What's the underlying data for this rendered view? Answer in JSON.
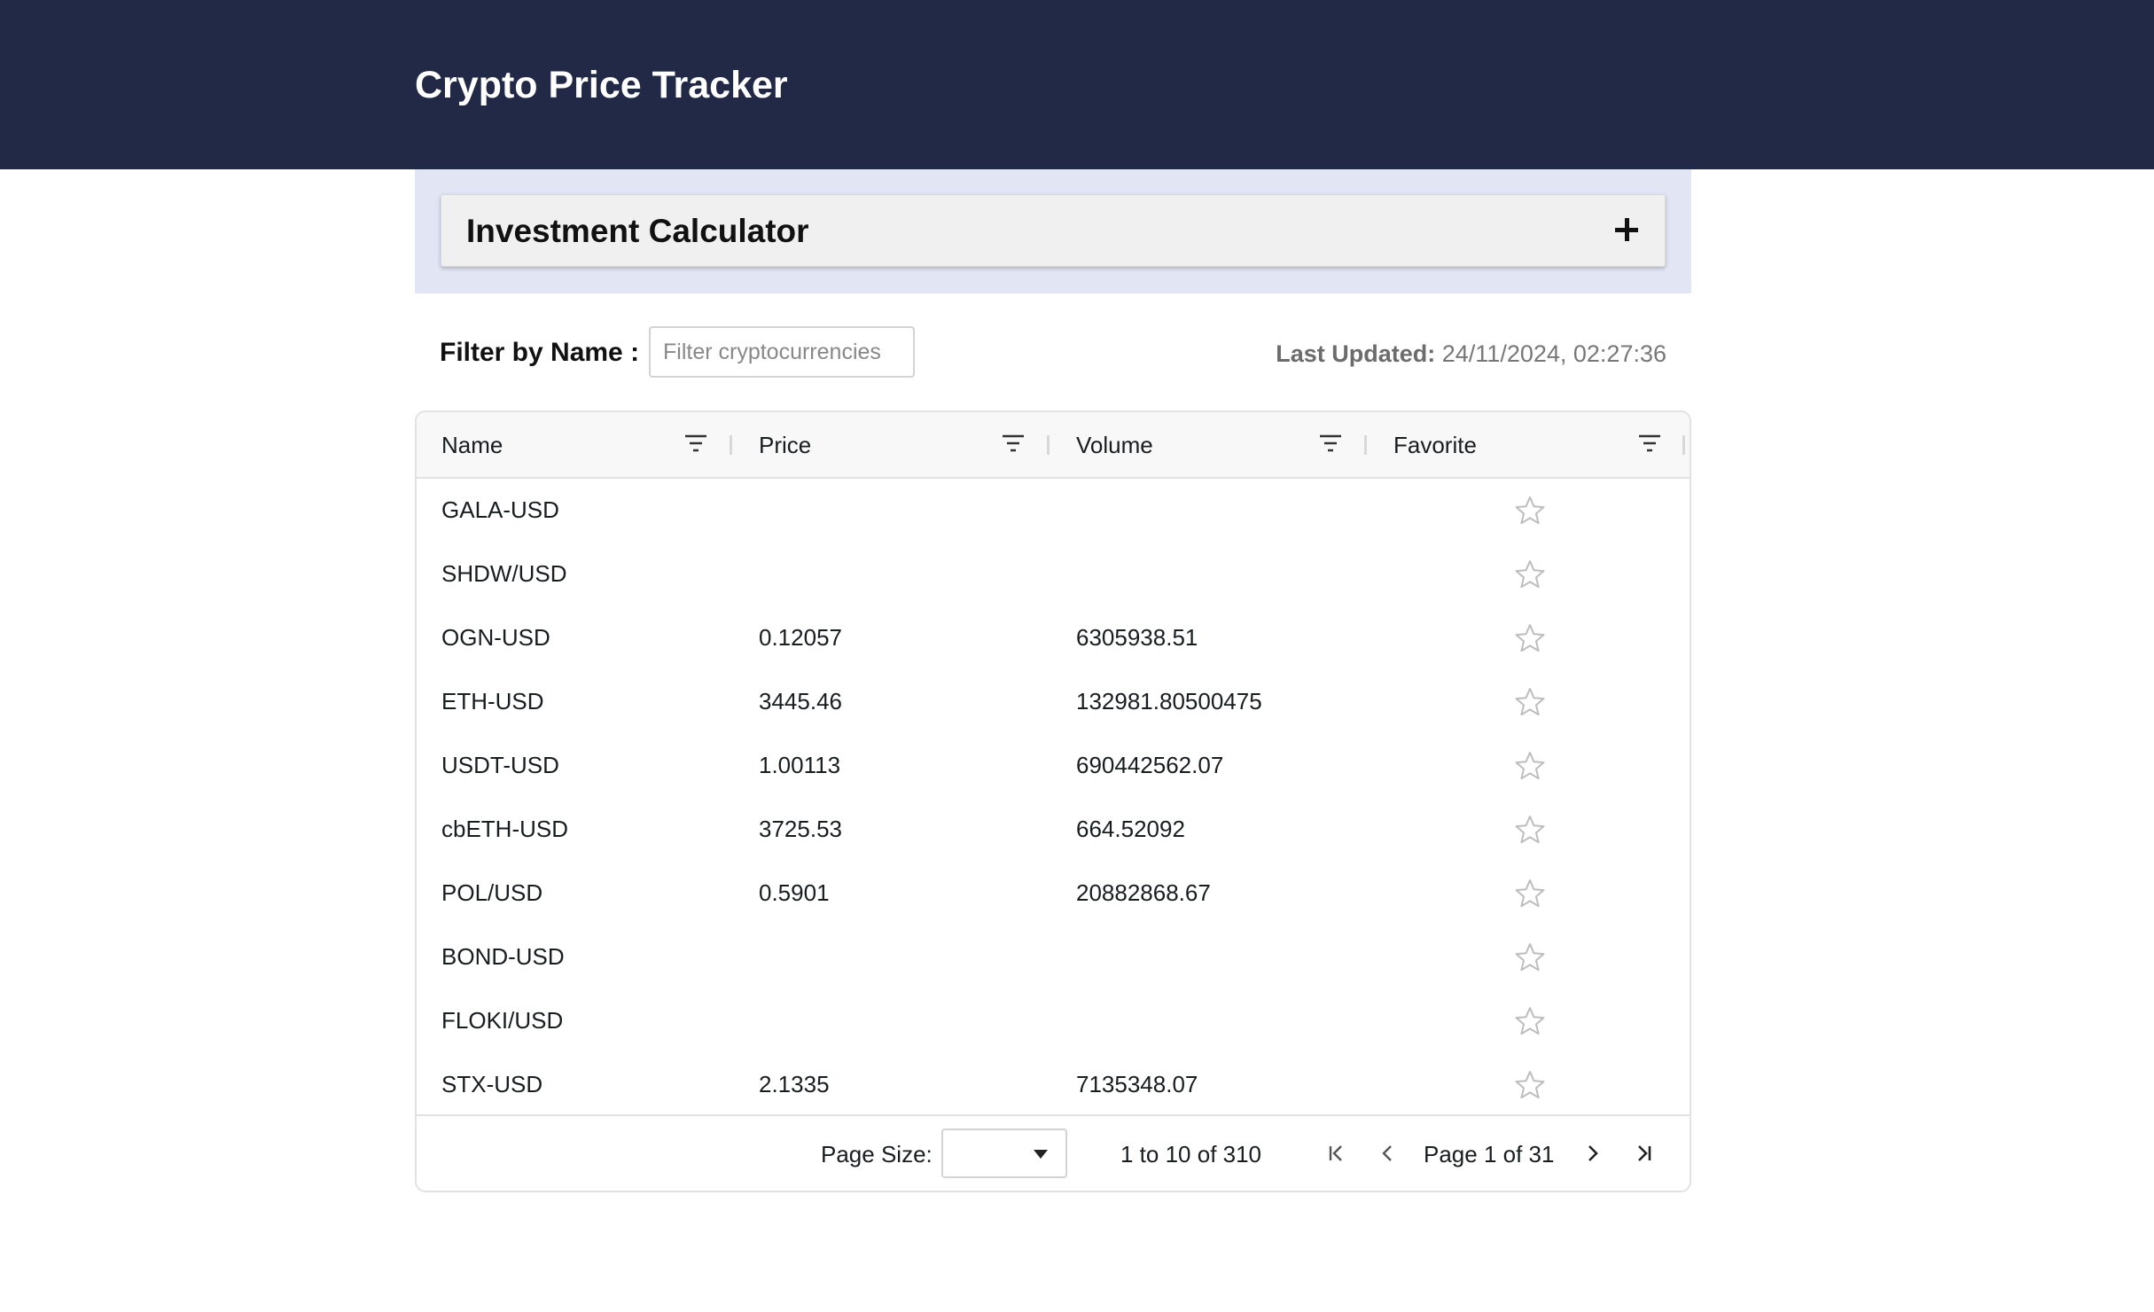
{
  "app": {
    "title": "Crypto Price Tracker"
  },
  "calculator": {
    "title": "Investment Calculator",
    "toggle_icon": "plus-icon"
  },
  "filter": {
    "label": "Filter by Name :",
    "placeholder": "Filter cryptocurrencies",
    "value": ""
  },
  "last_updated": {
    "label": "Last Updated:",
    "value": "24/11/2024, 02:27:36"
  },
  "grid": {
    "columns": [
      {
        "label": "Name"
      },
      {
        "label": "Price"
      },
      {
        "label": "Volume"
      },
      {
        "label": "Favorite"
      }
    ],
    "rows": [
      {
        "name": "GALA-USD",
        "price": "",
        "volume": "",
        "favorite": false
      },
      {
        "name": "SHDW/USD",
        "price": "",
        "volume": "",
        "favorite": false
      },
      {
        "name": "OGN-USD",
        "price": "0.12057",
        "volume": "6305938.51",
        "favorite": false
      },
      {
        "name": "ETH-USD",
        "price": "3445.46",
        "volume": "132981.80500475",
        "favorite": false
      },
      {
        "name": "USDT-USD",
        "price": "1.00113",
        "volume": "690442562.07",
        "favorite": false
      },
      {
        "name": "cbETH-USD",
        "price": "3725.53",
        "volume": "664.52092",
        "favorite": false
      },
      {
        "name": "POL/USD",
        "price": "0.5901",
        "volume": "20882868.67",
        "favorite": false
      },
      {
        "name": "BOND-USD",
        "price": "",
        "volume": "",
        "favorite": false
      },
      {
        "name": "FLOKI/USD",
        "price": "",
        "volume": "",
        "favorite": false
      },
      {
        "name": "STX-USD",
        "price": "2.1335",
        "volume": "7135348.07",
        "favorite": false
      }
    ]
  },
  "pagination": {
    "page_size_label": "Page Size:",
    "page_size_value": "",
    "summary": "1 to 10 of 310",
    "page_label": "Page 1 of 31"
  },
  "colors": {
    "header_bg": "#212946",
    "calculator_bg": "#e1e5f4",
    "star_outline": "#bdbdbd"
  }
}
